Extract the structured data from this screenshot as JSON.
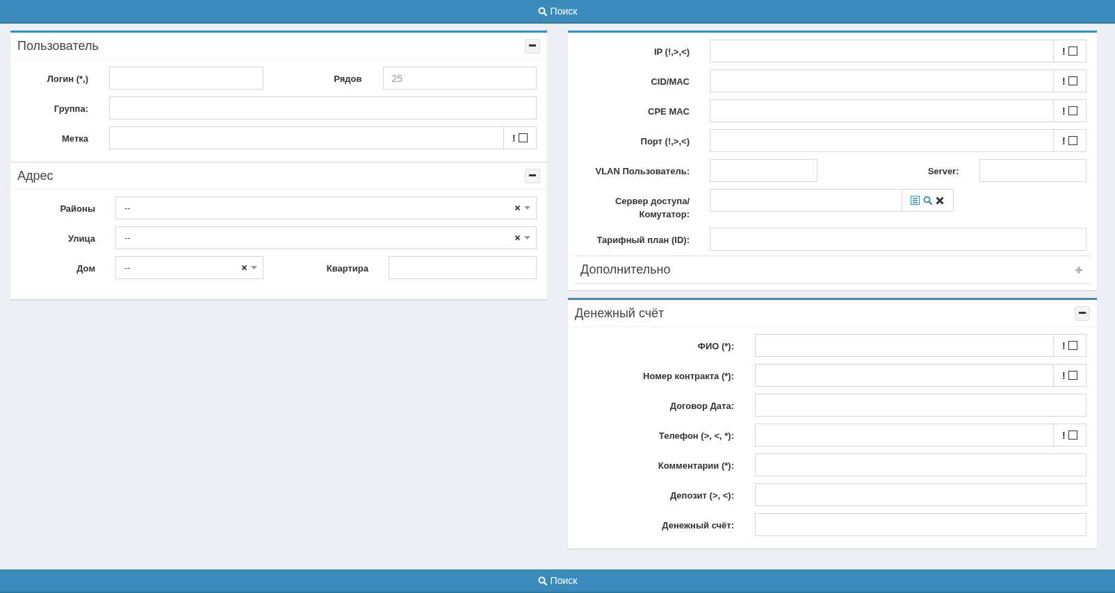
{
  "top_button": {
    "label": "Поиск"
  },
  "columns": [
    {
      "boxes": [
        {
          "sections": [
            {
              "kind": "panel",
              "title": "Пользователь",
              "expanded": true,
              "rows": [
                {
                  "fields": [
                    {
                      "kind": "input",
                      "label": "Логин (*,)"
                    },
                    {
                      "kind": "input",
                      "label": "Рядов",
                      "placeholder": "25"
                    }
                  ]
                },
                {
                  "fields": [
                    {
                      "kind": "input",
                      "label": "Группа:"
                    }
                  ]
                },
                {
                  "fields": [
                    {
                      "kind": "input",
                      "label": "Метка",
                      "flag": {
                        "mark": "!",
                        "checked": false
                      }
                    }
                  ]
                }
              ]
            },
            {
              "kind": "panel",
              "title": "Адрес",
              "expanded": true,
              "rows": [
                {
                  "fields": [
                    {
                      "kind": "select",
                      "label": "Районы",
                      "value": "--"
                    }
                  ]
                },
                {
                  "fields": [
                    {
                      "kind": "select",
                      "label": "Улица",
                      "value": "--"
                    }
                  ]
                },
                {
                  "fields": [
                    {
                      "kind": "select",
                      "label": "Дом",
                      "value": "--"
                    },
                    {
                      "kind": "input",
                      "label": "Квартира"
                    }
                  ]
                }
              ]
            }
          ]
        }
      ]
    },
    {
      "boxes": [
        {
          "sections": [
            {
              "kind": "plain",
              "rows": [
                {
                  "fields": [
                    {
                      "kind": "input",
                      "label": "IP (!,>,<)",
                      "flag": {
                        "mark": "!",
                        "checked": false
                      }
                    }
                  ]
                },
                {
                  "fields": [
                    {
                      "kind": "input",
                      "label": "CID/MAC",
                      "flag": {
                        "mark": "!",
                        "checked": false
                      }
                    }
                  ]
                },
                {
                  "fields": [
                    {
                      "kind": "input",
                      "label": "CPE MAC",
                      "flag": {
                        "mark": "!",
                        "checked": false
                      }
                    }
                  ]
                },
                {
                  "fields": [
                    {
                      "kind": "input",
                      "label": "Порт (!,>,<)",
                      "flag": {
                        "mark": "!",
                        "checked": false
                      }
                    }
                  ]
                },
                {
                  "fields": [
                    {
                      "kind": "input",
                      "label": "VLAN Пользователь:"
                    },
                    {
                      "kind": "input",
                      "label": "Server:"
                    }
                  ]
                },
                {
                  "fields": [
                    {
                      "kind": "lookup",
                      "label": "Сервер доступа/Комутатор:"
                    }
                  ]
                },
                {
                  "fields": [
                    {
                      "kind": "input",
                      "label": "Тарифный план (ID):"
                    }
                  ]
                }
              ]
            },
            {
              "kind": "fold",
              "title": "Дополнительно",
              "expanded": false
            }
          ]
        },
        {
          "sections": [
            {
              "kind": "panel",
              "title": "Денежный счёт",
              "expanded": true,
              "rows": [
                {
                  "fields": [
                    {
                      "kind": "input",
                      "label": "ФИО (*):",
                      "flag": {
                        "mark": "!",
                        "checked": false
                      }
                    }
                  ]
                },
                {
                  "fields": [
                    {
                      "kind": "input",
                      "label": "Номер контракта (*):",
                      "flag": {
                        "mark": "!",
                        "checked": false
                      }
                    }
                  ]
                },
                {
                  "fields": [
                    {
                      "kind": "input",
                      "label": "Договор Дата:"
                    }
                  ]
                },
                {
                  "fields": [
                    {
                      "kind": "input",
                      "label": "Телефон (>, <, *):",
                      "flag": {
                        "mark": "!",
                        "checked": false
                      }
                    }
                  ]
                },
                {
                  "fields": [
                    {
                      "kind": "input",
                      "label": "Комментарии (*):"
                    }
                  ]
                },
                {
                  "fields": [
                    {
                      "kind": "input",
                      "label": "Депозит (>, <):"
                    }
                  ]
                },
                {
                  "fields": [
                    {
                      "kind": "input",
                      "label": "Денежный счёт:"
                    }
                  ]
                }
              ]
            }
          ]
        }
      ]
    }
  ],
  "bottom_button": {
    "label": "Поиск"
  }
}
